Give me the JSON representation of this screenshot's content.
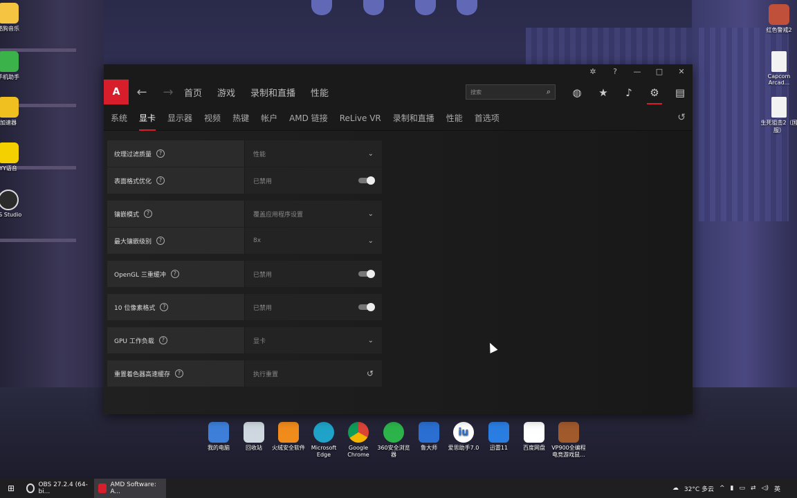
{
  "desktop": {
    "left_icons": [
      {
        "label": "酷狗音乐"
      },
      {
        "label": "手机助手"
      },
      {
        "label": "加速器"
      },
      {
        "label": "YY语音"
      },
      {
        "label": "BS Studio"
      }
    ],
    "right_icons": [
      {
        "label": "红色警戒2"
      },
      {
        "label": "Capcom Arcad..."
      },
      {
        "label": "生死狙击2（国服）"
      }
    ],
    "bottom_icons": [
      {
        "label": "我的电脑"
      },
      {
        "label": "回收站"
      },
      {
        "label": "火绒安全软件"
      },
      {
        "label": "Microsoft Edge"
      },
      {
        "label": "Google Chrome"
      },
      {
        "label": "360安全浏览器"
      },
      {
        "label": "鲁大师"
      },
      {
        "label": "爱思助手7.0"
      },
      {
        "label": "迅雷11"
      },
      {
        "label": "百度网盘"
      },
      {
        "label": "VP900全编程电竞游戏鼠..."
      }
    ]
  },
  "window": {
    "titlebar": {
      "bug_icon": "bug-icon",
      "help_icon": "help-icon",
      "minimize": "—",
      "maximize": "□",
      "close": "✕"
    },
    "logo": "A",
    "back": "←",
    "forward": "→",
    "topnav": [
      "首页",
      "游戏",
      "录制和直播",
      "性能"
    ],
    "search": {
      "placeholder": "搜索"
    },
    "header_icons": [
      "globe-icon",
      "star-icon",
      "bell-icon",
      "gear-icon",
      "sidebar-icon"
    ],
    "subnav": [
      "系统",
      "显卡",
      "显示器",
      "视频",
      "热键",
      "帐户",
      "AMD 链接",
      "ReLive VR",
      "录制和直播",
      "性能",
      "首选项"
    ],
    "subnav_active": "显卡",
    "settings": [
      {
        "label": "纹理过滤质量",
        "value": "性能",
        "control": "dropdown"
      },
      {
        "label": "表面格式优化",
        "value": "已禁用",
        "control": "toggle"
      },
      {
        "label": "镶嵌模式",
        "value": "覆盖应用程序设置",
        "control": "dropdown"
      },
      {
        "label": "最大镶嵌级别",
        "value": "8x",
        "control": "dropdown"
      },
      {
        "label": "OpenGL 三重缓冲",
        "value": "已禁用",
        "control": "toggle"
      },
      {
        "label": "10 位像素格式",
        "value": "已禁用",
        "control": "toggle"
      },
      {
        "label": "GPU 工作负载",
        "value": "显卡",
        "control": "dropdown"
      },
      {
        "label": "重置着色器高速缓存",
        "value": "执行重置",
        "control": "reset"
      }
    ]
  },
  "taskbar": {
    "tasks": [
      {
        "label": "OBS 27.2.4 (64-bi..."
      },
      {
        "label": "AMD Software: A..."
      }
    ],
    "weather": "32°C 多云",
    "lang": "英"
  }
}
